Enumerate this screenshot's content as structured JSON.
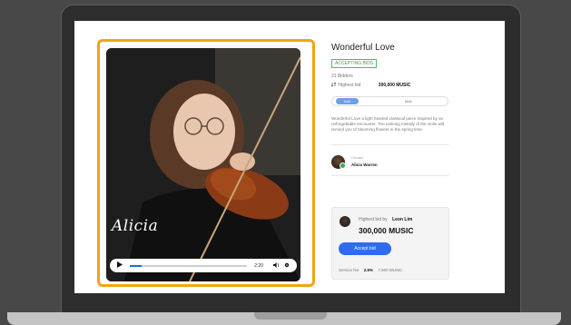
{
  "nft": {
    "title": "Wonderful Love",
    "status_badge": "ACCEPTING BIDS",
    "bidders_count": "21 Bidders",
    "highest_bid_label": "Highest bid",
    "highest_bid_value": "300,000 MUSIC",
    "signature_text": "Alicia"
  },
  "tabs": [
    {
      "label": "Info",
      "active": true
    },
    {
      "label": "Bids",
      "active": false
    }
  ],
  "description": "Wonderful Love a light hearted classical piece inspired by an unforgettable encounter.  The calming melody of the violin will remind you of blooming flowers in the spring time.",
  "creator": {
    "label": "Creator",
    "name": "Alicia Warren"
  },
  "bid_card": {
    "highest_bid_by_label": "Highest bid by",
    "bidder_name": "Leon Lim",
    "amount": "300,000 MUSIC",
    "accept_button": "Accept bid",
    "service_fee_label": "Service fee",
    "service_fee_percent": "2.5%",
    "service_fee_amount": "7,500 MUSIC"
  },
  "player": {
    "time": "2:20",
    "progress_fraction": 0.1
  },
  "colors": {
    "accent_frame": "#f2a412",
    "primary_button": "#2f6bf0",
    "badge_green": "#3d9e51"
  },
  "icons": [
    "play-icon",
    "volume-icon",
    "settings-icon",
    "bid-icon",
    "verified-check-icon"
  ]
}
